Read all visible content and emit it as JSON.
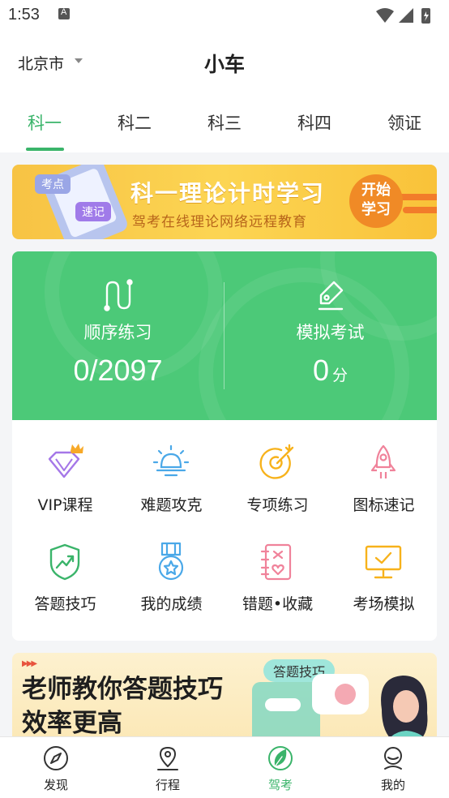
{
  "status_bar": {
    "time": "1:53"
  },
  "header": {
    "city": "北京市",
    "title": "小车"
  },
  "tabs": [
    {
      "label": "科一",
      "active": true
    },
    {
      "label": "科二",
      "active": false
    },
    {
      "label": "科三",
      "active": false
    },
    {
      "label": "科四",
      "active": false
    },
    {
      "label": "领证",
      "active": false
    }
  ],
  "banner_top": {
    "tag1": "考点",
    "tag2": "速记",
    "title": "科一理论计时学习",
    "subtitle": "驾考在线理论网络远程教育",
    "button_line1": "开始",
    "button_line2": "学习"
  },
  "stats": {
    "sequential": {
      "label": "顺序练习",
      "value": "0/2097"
    },
    "mock": {
      "label": "模拟考试",
      "value": "0",
      "unit": "分"
    }
  },
  "grid": [
    {
      "label": "VIP课程",
      "icon": "diamond-crown-icon"
    },
    {
      "label": "难题攻克",
      "icon": "lightbulb-icon"
    },
    {
      "label": "专项练习",
      "icon": "target-icon"
    },
    {
      "label": "图标速记",
      "icon": "rocket-icon"
    },
    {
      "label": "答题技巧",
      "icon": "shield-trend-icon"
    },
    {
      "label": "我的成绩",
      "icon": "medal-icon"
    },
    {
      "label": "错题•收藏",
      "icon": "notebook-heart-icon"
    },
    {
      "label": "考场模拟",
      "icon": "monitor-check-icon"
    }
  ],
  "banner_bottom": {
    "title_line1": "老师教你答题技巧",
    "title_line2": "效率更高",
    "tag": "答题技巧"
  },
  "nav": [
    {
      "label": "发现",
      "icon": "compass-icon",
      "active": false
    },
    {
      "label": "行程",
      "icon": "location-pin-icon",
      "active": false
    },
    {
      "label": "驾考",
      "icon": "leaf-icon",
      "active": true
    },
    {
      "label": "我的",
      "icon": "profile-icon",
      "active": false
    }
  ],
  "colors": {
    "accent": "#3ab46a",
    "stats_bg": "#4cc978",
    "banner_yellow": "#fcd553",
    "banner_orange": "#f08a26"
  }
}
